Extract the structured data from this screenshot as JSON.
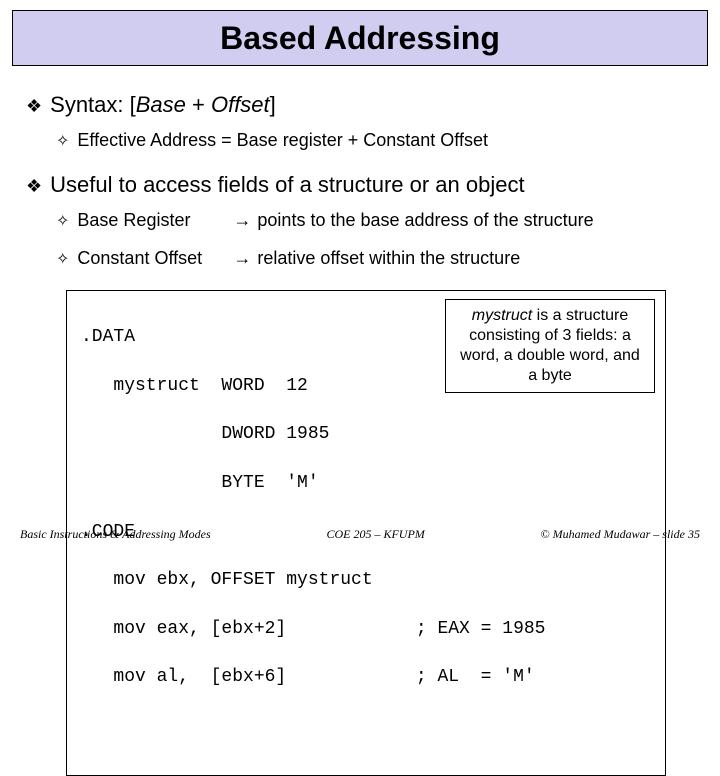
{
  "title": "Based Addressing",
  "bullets": {
    "syntax_prefix": "Syntax: [",
    "syntax_base": "Base",
    "syntax_plus": " + ",
    "syntax_offset": "Offset",
    "syntax_suffix": "]",
    "effective": "Effective Address = Base register + Constant Offset",
    "useful": "Useful to access fields of a structure or an object",
    "basereg_label": "Base Register",
    "arrow": "→",
    "basereg_desc": "points to the base address of the structure",
    "offset_label": "Constant Offset",
    "offset_desc": "relative offset within the structure"
  },
  "code": {
    "l1": ".DATA",
    "l2": "   mystruct  WORD  12",
    "l3": "             DWORD 1985",
    "l4": "             BYTE  'M'",
    "l5": ".CODE",
    "l6": "   mov ebx, OFFSET mystruct",
    "l7": "   mov eax, [ebx+2]            ; EAX = 1985",
    "l8": "   mov al,  [ebx+6]            ; AL  = 'M'"
  },
  "infobox": {
    "word": "mystruct",
    "rest": " is a structure consisting of 3 fields: a word, a double word, and a byte"
  },
  "footer": {
    "left": "Basic Instructions & Addressing Modes",
    "center": "COE 205 – KFUPM",
    "right": "© Muhamed Mudawar – slide 35"
  }
}
